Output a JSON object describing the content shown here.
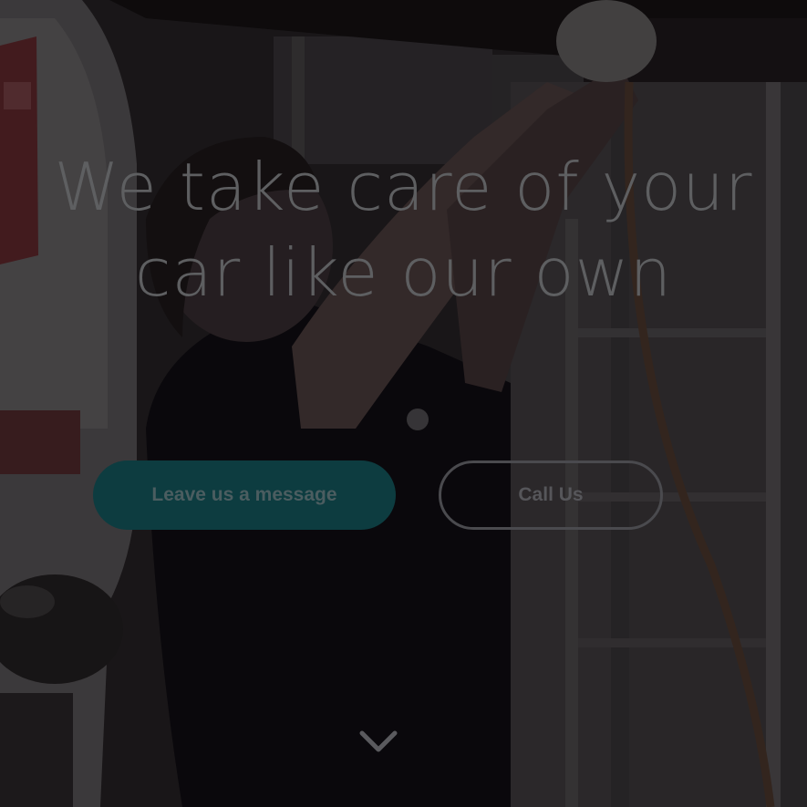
{
  "hero": {
    "headline_line1": "We take care of your",
    "headline_line2": "car like our own",
    "primary_button_label": "Leave us a message",
    "secondary_button_label": "Call Us",
    "scroll_icon": "chevron-down-icon"
  },
  "colors": {
    "primary_button_bg": "#0d3c40",
    "headline_text": "#5e5f61",
    "overlay": "#0f0d10"
  }
}
